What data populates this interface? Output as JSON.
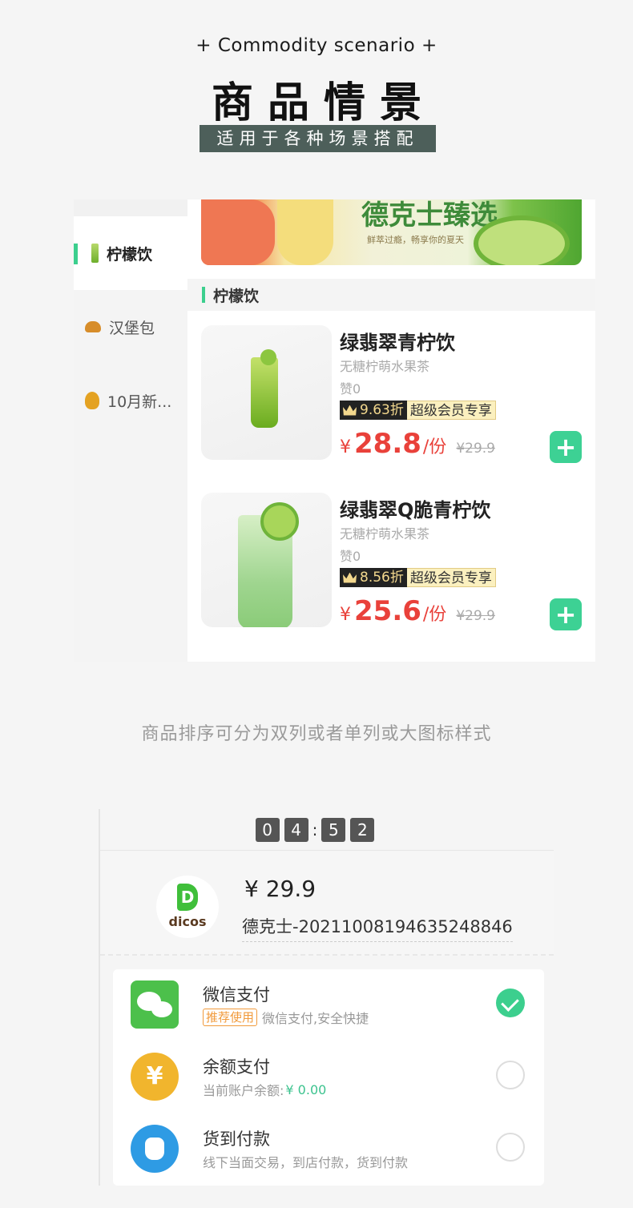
{
  "header": {
    "subtitle_en": "+ Commodity scenario  +",
    "title_cn": "商品情景",
    "tagline": "适用于各种场景搭配"
  },
  "menu_screen": {
    "sidebar": {
      "items": [
        {
          "label": "柠檬饮",
          "icon": "lemon-drink-icon",
          "active": true
        },
        {
          "label": "汉堡包",
          "icon": "burger-icon",
          "active": false
        },
        {
          "label": "10月新...",
          "icon": "flower-icon",
          "active": false
        }
      ]
    },
    "banner": {
      "title": "德克士臻选",
      "subtitle": "鲜萃过瘾，畅享你的夏天"
    },
    "section_title": "柠檬饮",
    "products": [
      {
        "name": "绿翡翠青柠饮",
        "desc": "无糖柠萌水果茶",
        "likes": "赞0",
        "vip_discount": "9.63折",
        "vip_label": "超级会员专享",
        "currency": "¥",
        "price": "28.8",
        "unit": "/份",
        "old_price": "¥29.9"
      },
      {
        "name": "绿翡翠Q脆青柠饮",
        "desc": "无糖柠萌水果茶",
        "likes": "赞0",
        "vip_discount": "8.56折",
        "vip_label": "超级会员专享",
        "currency": "¥",
        "price": "25.6",
        "unit": "/份",
        "old_price": "¥29.9"
      }
    ],
    "add_button_label": "+"
  },
  "caption": "商品排序可分为双列或者单列或大图标样式",
  "payment_screen": {
    "timer": {
      "d1": "0",
      "d2": "4",
      "sep": ":",
      "d3": "5",
      "d4": "2"
    },
    "brand_logo_text": "dicos",
    "brand_logo_letter": "D",
    "amount": "¥ 29.9",
    "order_no": "德克士-20211008194635248846",
    "methods": [
      {
        "title": "微信支付",
        "tag": "推荐使用",
        "sub": "微信支付,安全快捷",
        "icon": "wechat-pay-icon",
        "selected": true
      },
      {
        "title": "余额支付",
        "sub": "当前账户余额:",
        "balance": "¥ 0.00",
        "icon": "balance-icon",
        "symbol": "¥",
        "selected": false
      },
      {
        "title": "货到付款",
        "sub": "线下当面交易，到店付款，货到付款",
        "icon": "cash-on-delivery-icon",
        "selected": false
      }
    ],
    "colors": {
      "accent": "#3ccf8e",
      "price_red": "#e9413a",
      "tag_orange": "#f19a3b"
    }
  }
}
